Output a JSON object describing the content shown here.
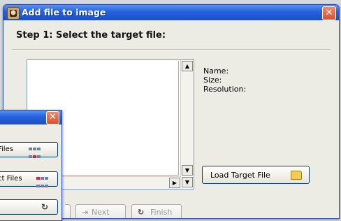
{
  "main_window": {
    "title": "Add file to image",
    "step_title": "Step 1: Select the target file:",
    "info": {
      "name_label": "Name:",
      "size_label": "Size:",
      "resolution_label": "Resolution:"
    },
    "load_button": "Load Target File",
    "nav": {
      "next": "Next",
      "finish": "Finish"
    }
  },
  "secondary_window": {
    "buttons": [
      "Files",
      "ct Files"
    ]
  },
  "icons": [
    "app-icon",
    "close-icon",
    "folder-icon",
    "scroll-up-icon",
    "scroll-down-icon",
    "scroll-right-icon",
    "next-arrow-icon",
    "refresh-icon"
  ],
  "colors": {
    "titlebar": "#2561dd",
    "close": "#d9502b",
    "window_bg": "#ecebe4"
  }
}
